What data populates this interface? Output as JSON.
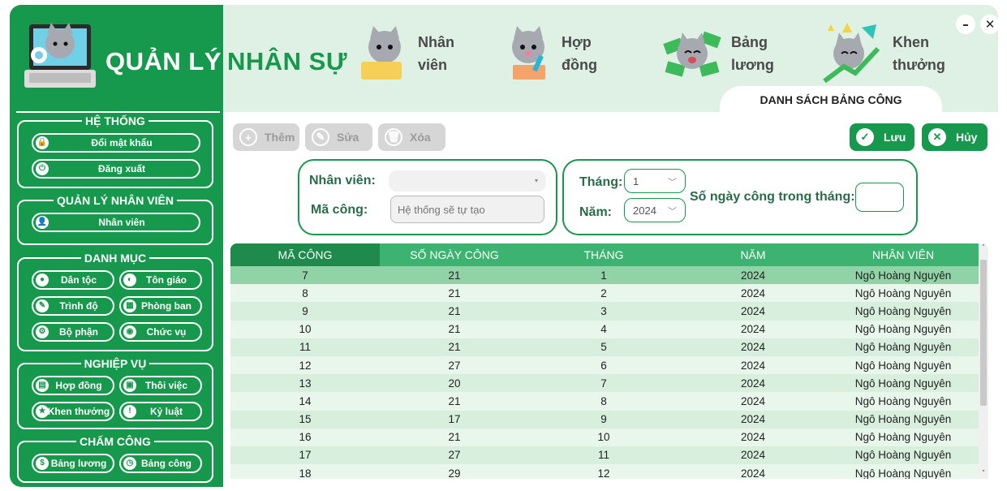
{
  "header": {
    "brand_title_light": "QUẢN LÝ",
    "brand_title_dark": "NHÂN SỰ",
    "nav": [
      {
        "label_line1": "Nhân",
        "label_line2": "viên",
        "icon": "cat-laptop-icon"
      },
      {
        "label_line1": "Hợp",
        "label_line2": "đồng",
        "icon": "cat-pen-icon"
      },
      {
        "label_line1": "Bảng",
        "label_line2": "lương",
        "icon": "cat-money-icon"
      },
      {
        "label_line1": "Khen",
        "label_line2": "thưởng",
        "icon": "cat-trophy-icon"
      }
    ],
    "tab_title": "DANH SÁCH BẢNG CÔNG",
    "minimize": "–",
    "close": "✕"
  },
  "sidebar": {
    "groups": [
      {
        "title": "HỆ THỐNG",
        "items": [
          "Đổi mật khẩu",
          "Đăng xuất"
        ]
      },
      {
        "title": "QUẢN LÝ NHÂN VIÊN",
        "items": [
          "Nhân viên"
        ]
      },
      {
        "title": "DANH MỤC",
        "items": [
          "Dân tộc",
          "Tôn giáo",
          "Trình độ",
          "Phòng ban",
          "Bộ phận",
          "Chức vụ"
        ]
      },
      {
        "title": "NGHIỆP VỤ",
        "items": [
          "Hợp đồng",
          "Thôi việc",
          "Khen thưởng",
          "Kỷ luật"
        ]
      },
      {
        "title": "CHẤM CÔNG",
        "items": [
          "Bảng lương",
          "Bảng công"
        ]
      }
    ]
  },
  "toolbar": {
    "add": "Thêm",
    "edit": "Sửa",
    "delete": "Xóa",
    "save": "Lưu",
    "cancel": "Hủy"
  },
  "form": {
    "employee_label": "Nhân viên:",
    "employee_value": "",
    "code_label": "Mã công:",
    "code_placeholder": "Hệ thống sẽ tự tạo",
    "month_label": "Tháng:",
    "month_value": "1",
    "year_label": "Năm:",
    "year_value": "2024",
    "days_label": "Số ngày công trong tháng:",
    "days_value": ""
  },
  "table": {
    "columns": [
      "MÃ CÔNG",
      "SỐ NGÀY CÔNG",
      "THÁNG",
      "NĂM",
      "NHÂN VIÊN"
    ],
    "rows": [
      [
        "7",
        "21",
        "1",
        "2024",
        "Ngô Hoàng Nguyên"
      ],
      [
        "8",
        "21",
        "2",
        "2024",
        "Ngô Hoàng Nguyên"
      ],
      [
        "9",
        "21",
        "3",
        "2024",
        "Ngô Hoàng Nguyên"
      ],
      [
        "10",
        "21",
        "4",
        "2024",
        "Ngô Hoàng Nguyên"
      ],
      [
        "11",
        "21",
        "5",
        "2024",
        "Ngô Hoàng Nguyên"
      ],
      [
        "12",
        "27",
        "6",
        "2024",
        "Ngô Hoàng Nguyên"
      ],
      [
        "13",
        "20",
        "7",
        "2024",
        "Ngô Hoàng Nguyên"
      ],
      [
        "14",
        "21",
        "8",
        "2024",
        "Ngô Hoàng Nguyên"
      ],
      [
        "15",
        "17",
        "9",
        "2024",
        "Ngô Hoàng Nguyên"
      ],
      [
        "16",
        "21",
        "10",
        "2024",
        "Ngô Hoàng Nguyên"
      ],
      [
        "17",
        "27",
        "11",
        "2024",
        "Ngô Hoàng Nguyên"
      ],
      [
        "18",
        "29",
        "12",
        "2024",
        "Ngô Hoàng Nguyên"
      ]
    ]
  },
  "colors": {
    "primary": "#16994c",
    "header_bg": "#dff1e4",
    "table_head": "#3cb371"
  }
}
